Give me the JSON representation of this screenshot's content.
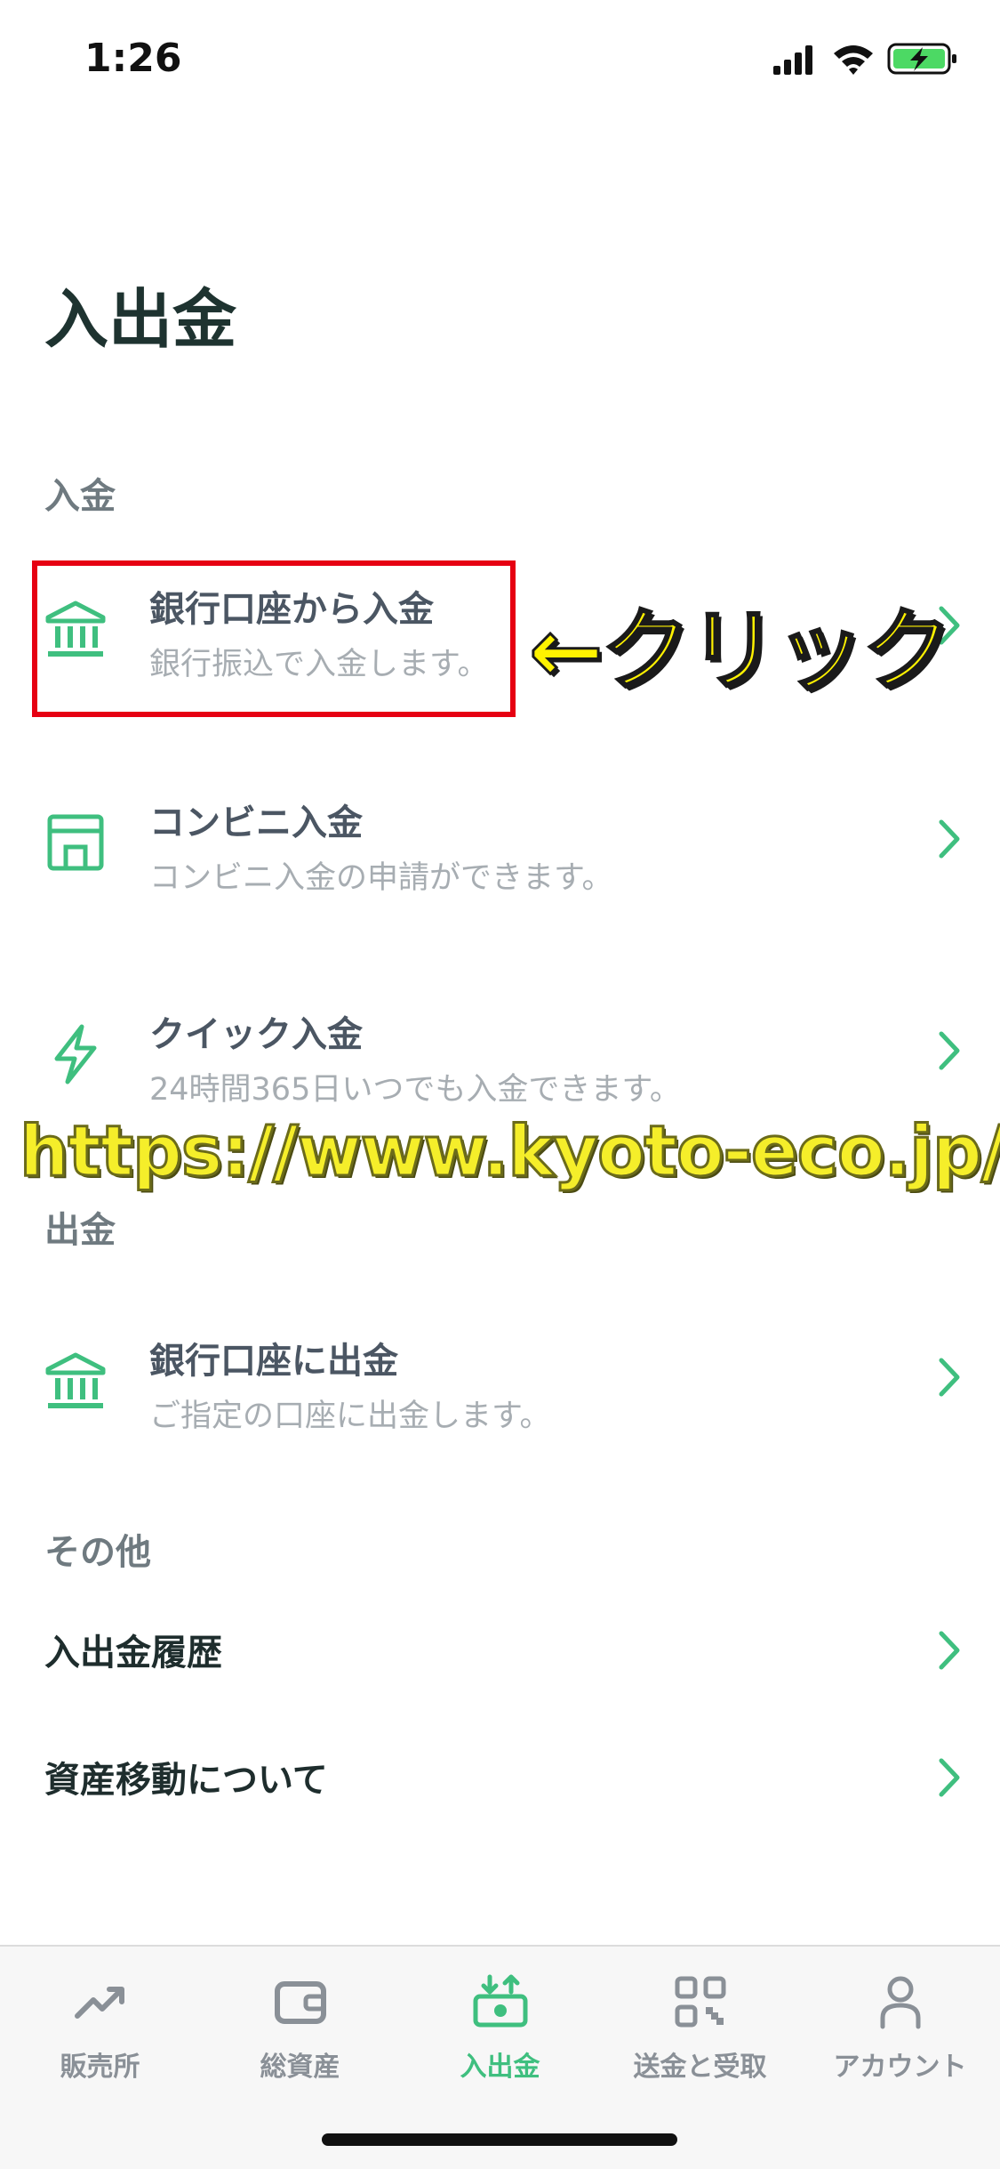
{
  "status_bar": {
    "time": "1:26"
  },
  "page_title": "入出金",
  "sections": {
    "deposit": {
      "label": "入金",
      "items": [
        {
          "title": "銀行口座から入金",
          "subtitle": "銀行振込で入金します。",
          "icon": "bank-icon"
        },
        {
          "title": "コンビニ入金",
          "subtitle": "コンビニ入金の申請ができます。",
          "icon": "store-icon"
        },
        {
          "title": "クイック入金",
          "subtitle": "24時間365日いつでも入金できます。",
          "icon": "lightning-icon"
        }
      ]
    },
    "withdraw": {
      "label": "出金",
      "items": [
        {
          "title": "銀行口座に出金",
          "subtitle": "ご指定の口座に出金します。",
          "icon": "bank-icon"
        }
      ]
    },
    "other": {
      "label": "その他",
      "items": [
        {
          "title": "入出金履歴"
        },
        {
          "title": "資産移動について"
        }
      ]
    }
  },
  "annotation": {
    "text": "←クリック"
  },
  "watermark": {
    "text": "https://www.kyoto-eco.jp/"
  },
  "tab_bar": {
    "active": "入出金",
    "items": [
      {
        "label": "販売所",
        "icon": "trend-icon"
      },
      {
        "label": "総資産",
        "icon": "wallet-icon"
      },
      {
        "label": "入出金",
        "icon": "deposit-withdraw-icon"
      },
      {
        "label": "送金と受取",
        "icon": "qr-code-icon"
      },
      {
        "label": "アカウント",
        "icon": "person-icon"
      }
    ]
  },
  "colors": {
    "accent": "#3fbf7f",
    "highlight_box": "#e60012",
    "annotation": "#fff200"
  }
}
